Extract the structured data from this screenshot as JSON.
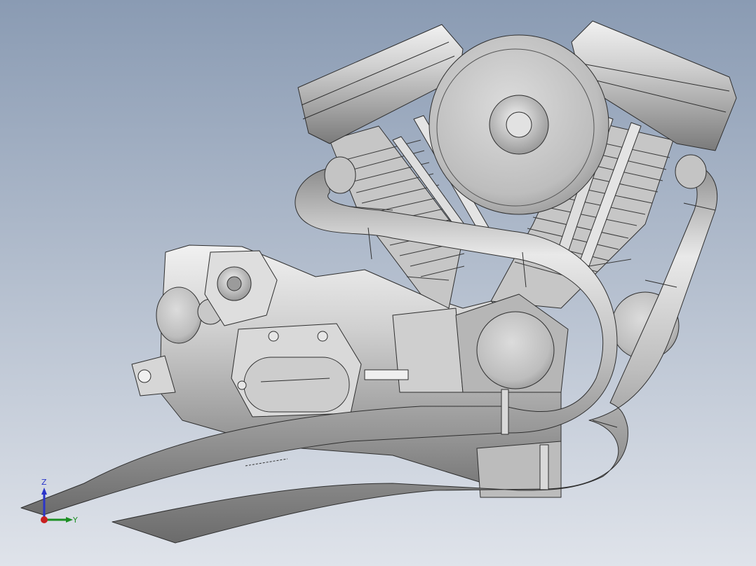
{
  "viewport": {
    "background_top": "#8a9bb3",
    "background_bottom": "#dfe3ea"
  },
  "model": {
    "metal_light": "#e7e7e7",
    "metal_mid": "#b8b8b8",
    "metal_dark": "#6f6f6f",
    "edge": "#2f2f2f"
  },
  "triad": {
    "z_label": "Z",
    "y_label": "Y",
    "z_color": "#2a34c9",
    "y_color": "#1b8f23",
    "x_color": "#c82020"
  }
}
